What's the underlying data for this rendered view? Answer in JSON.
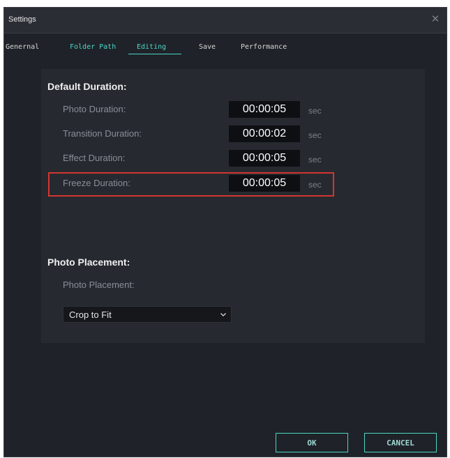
{
  "window": {
    "title": "Settings"
  },
  "icons": {
    "close": "close-icon",
    "dropdown": "chevron-down-icon"
  },
  "tabs": [
    {
      "label": "Genernal",
      "active": false
    },
    {
      "label": "Folder Path",
      "active": false
    },
    {
      "label": "Editing",
      "active": true
    },
    {
      "label": "Save",
      "active": false
    },
    {
      "label": "Performance",
      "active": false
    }
  ],
  "default_duration": {
    "title": "Default Duration:",
    "rows": [
      {
        "label": "Photo Duration:",
        "value": "00:00:05",
        "unit": "sec"
      },
      {
        "label": "Transition Duration:",
        "value": "00:00:02",
        "unit": "sec"
      },
      {
        "label": "Effect Duration:",
        "value": "00:00:05",
        "unit": "sec"
      },
      {
        "label": "Freeze Duration:",
        "value": "00:00:05",
        "unit": "sec",
        "highlighted": true
      }
    ]
  },
  "photo_placement": {
    "title": "Photo Placement:",
    "label": "Photo Placement:",
    "selected": "Crop to Fit"
  },
  "buttons": {
    "ok": "OK",
    "cancel": "CANCEL"
  },
  "colors": {
    "accent": "#4dd6c6",
    "highlight": "#d4362f",
    "background": "#1f2228"
  }
}
